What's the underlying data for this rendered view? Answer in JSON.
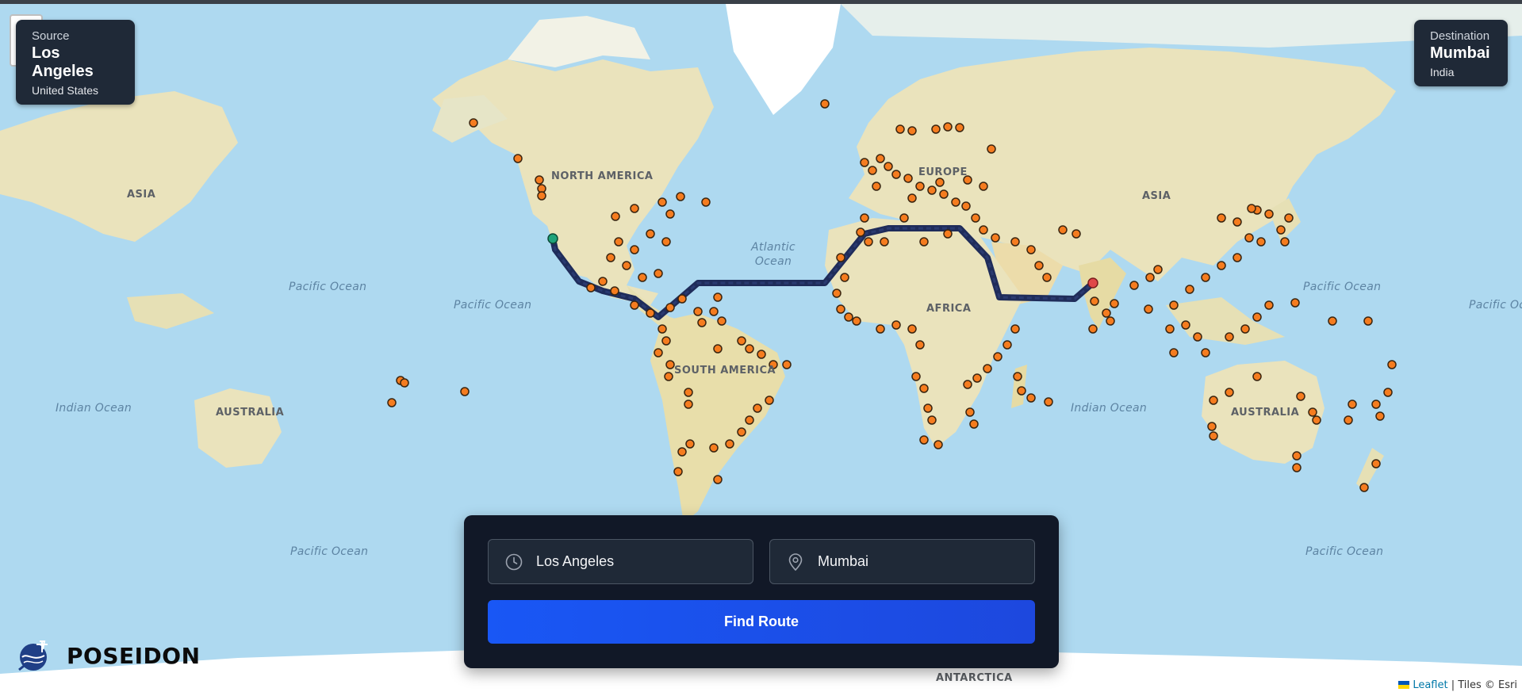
{
  "source_card": {
    "heading": "Source",
    "city": "Los Angeles",
    "country": "United States"
  },
  "destination_card": {
    "heading": "Destination",
    "city": "Mumbai",
    "country": "India"
  },
  "map": {
    "labels": {
      "north_america": "NORTH AMERICA",
      "south_america": "SOUTH AMERICA",
      "europe": "EUROPE",
      "africa": "AFRICA",
      "asia": "ASIA",
      "australia": "AUSTRALIA",
      "antarctica": "ANTARCTICA",
      "pacific_ocean": "Pacific Ocean",
      "atlantic_ocean": "Atlantic Ocean",
      "indian_ocean": "Indian Ocean"
    },
    "colors": {
      "water": "#9fd3ee",
      "land": "#eae3bc",
      "ice": "#ffffff",
      "port": "#f57c1f",
      "route": "#1f2c5a",
      "source_marker": "#1fa37a",
      "destination_marker": "#e04848"
    }
  },
  "search": {
    "source_value": "Los Angeles",
    "destination_value": "Mumbai",
    "find_label": "Find Route"
  },
  "brand": {
    "name": "POSEIDON"
  },
  "attribution": {
    "leaflet": "Leaflet",
    "separator": " | ",
    "tiles": "Tiles © Esri"
  }
}
